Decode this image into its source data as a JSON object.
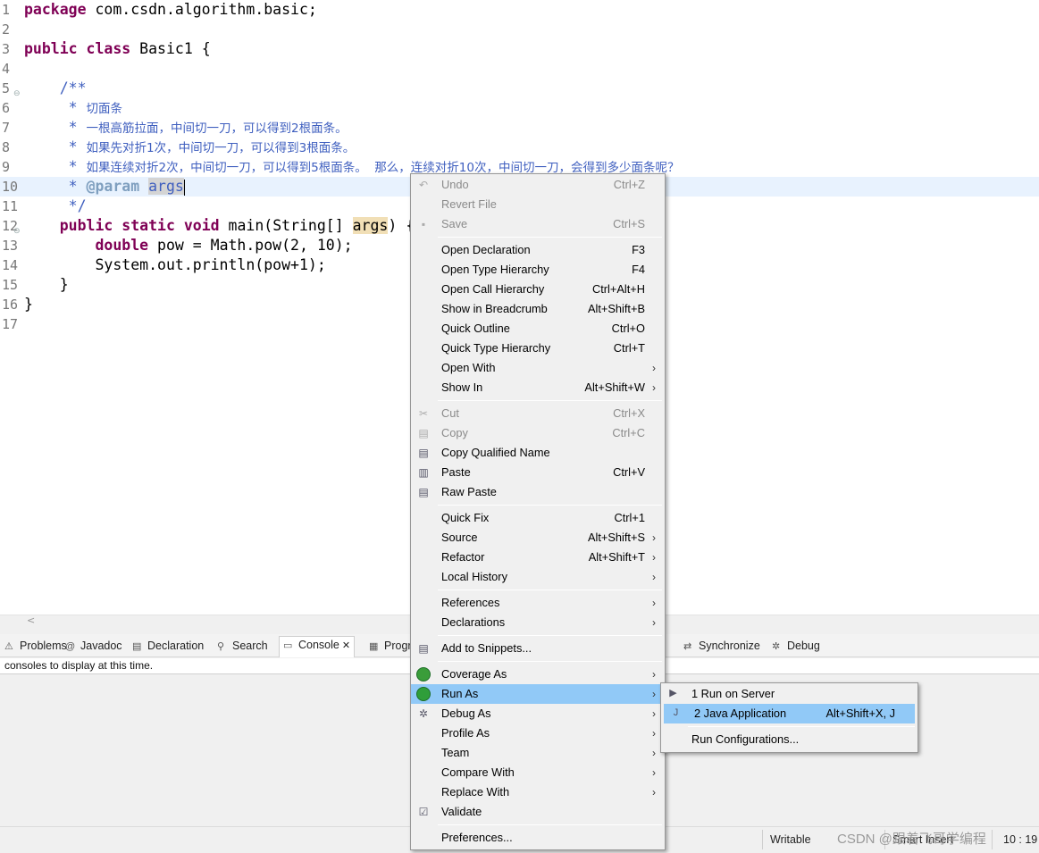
{
  "editor": {
    "lines": [
      {
        "num": "1",
        "parts": [
          {
            "t": "package",
            "c": "kw"
          },
          {
            "t": " com.csdn.algorithm.basic;"
          }
        ]
      },
      {
        "num": "2",
        "parts": []
      },
      {
        "num": "3",
        "parts": [
          {
            "t": "public",
            "c": "kw"
          },
          {
            "t": " "
          },
          {
            "t": "class",
            "c": "kw"
          },
          {
            "t": " Basic1 {"
          }
        ]
      },
      {
        "num": "4",
        "parts": []
      },
      {
        "num": "5",
        "fold": true,
        "parts": [
          {
            "t": "    /**",
            "c": "jd"
          }
        ]
      },
      {
        "num": "6",
        "parts": [
          {
            "t": "     * ",
            "c": "jd"
          },
          {
            "t": "切面条",
            "c": "jdz"
          }
        ]
      },
      {
        "num": "7",
        "parts": [
          {
            "t": "     * ",
            "c": "jd"
          },
          {
            "t": "一根高筋拉面，中间切一刀，可以得到2根面条。",
            "c": "jdz"
          }
        ]
      },
      {
        "num": "8",
        "parts": [
          {
            "t": "     * ",
            "c": "jd"
          },
          {
            "t": "如果先对折1次，中间切一刀，可以得到3根面条。",
            "c": "jdz"
          }
        ]
      },
      {
        "num": "9",
        "parts": [
          {
            "t": "     * ",
            "c": "jd"
          },
          {
            "t": "如果连续对折2次，中间切一刀，可以得到5根面条。  那么，连续对折10次，中间切一刀，会得到多少面条呢？",
            "c": "jdz"
          }
        ]
      },
      {
        "num": "10",
        "current": true,
        "parts": [
          {
            "t": "     * ",
            "c": "jd"
          },
          {
            "t": "@param",
            "c": "tag"
          },
          {
            "t": " "
          },
          {
            "t": "args",
            "c": "jd hl"
          },
          {
            "caret": true
          }
        ]
      },
      {
        "num": "11",
        "parts": [
          {
            "t": "     */",
            "c": "jd"
          }
        ]
      },
      {
        "num": "12",
        "fold": true,
        "parts": [
          {
            "t": "    "
          },
          {
            "t": "public",
            "c": "kw"
          },
          {
            "t": " "
          },
          {
            "t": "static",
            "c": "kw"
          },
          {
            "t": " "
          },
          {
            "t": "void",
            "c": "kw"
          },
          {
            "t": " main(String[] "
          },
          {
            "t": "args",
            "c": "hl2"
          },
          {
            "t": ") {"
          }
        ]
      },
      {
        "num": "13",
        "parts": [
          {
            "t": "        "
          },
          {
            "t": "double",
            "c": "kw"
          },
          {
            "t": " pow = Math.pow(2, 10);"
          }
        ]
      },
      {
        "num": "14",
        "parts": [
          {
            "t": "        System.out.println(pow+1);"
          }
        ]
      },
      {
        "num": "15",
        "parts": [
          {
            "t": "    }"
          }
        ]
      },
      {
        "num": "16",
        "parts": [
          {
            "t": "}"
          }
        ]
      },
      {
        "num": "17",
        "parts": []
      }
    ]
  },
  "views": {
    "tabs": [
      {
        "id": "problems",
        "label": "Problems",
        "icon": "problems-icon",
        "glyph": "⚠"
      },
      {
        "id": "javadoc",
        "label": "Javadoc",
        "icon": "javadoc-icon",
        "glyph": "@"
      },
      {
        "id": "declaration",
        "label": "Declaration",
        "icon": "declaration-icon",
        "glyph": "▤"
      },
      {
        "id": "search",
        "label": "Search",
        "icon": "search-icon",
        "glyph": "⚲"
      },
      {
        "id": "console",
        "label": "Console",
        "icon": "console-icon",
        "glyph": "▭",
        "active": true,
        "close": "✕"
      },
      {
        "id": "progress",
        "label": "Progr",
        "icon": "progress-icon",
        "glyph": "▦"
      },
      {
        "id": "servers",
        "label": "rs",
        "icon": "servers-icon",
        "glyph": ""
      },
      {
        "id": "synchronize",
        "label": "Synchronize",
        "icon": "synchronize-icon",
        "glyph": "⇄"
      },
      {
        "id": "debug",
        "label": "Debug",
        "icon": "debug-icon",
        "glyph": "✲"
      }
    ],
    "console_message": "consoles to display at this time."
  },
  "status": {
    "writable": "Writable",
    "insert_mode": "Smart Insert",
    "position": "10 : 19",
    "watermark": "CSDN @跟着飞哥学编程"
  },
  "context_menu": {
    "items": [
      {
        "type": "item",
        "label": "Undo",
        "shortcut": "Ctrl+Z",
        "disabled": true,
        "icon": "undo-icon",
        "glyph": "↶"
      },
      {
        "type": "item",
        "label": "Revert File",
        "disabled": true
      },
      {
        "type": "item",
        "label": "Save",
        "shortcut": "Ctrl+S",
        "disabled": true,
        "icon": "save-icon",
        "glyph": "▪"
      },
      {
        "type": "sep"
      },
      {
        "type": "item",
        "label": "Open Declaration",
        "shortcut": "F3"
      },
      {
        "type": "item",
        "label": "Open Type Hierarchy",
        "shortcut": "F4"
      },
      {
        "type": "item",
        "label": "Open Call Hierarchy",
        "shortcut": "Ctrl+Alt+H"
      },
      {
        "type": "item",
        "label": "Show in Breadcrumb",
        "shortcut": "Alt+Shift+B"
      },
      {
        "type": "item",
        "label": "Quick Outline",
        "shortcut": "Ctrl+O"
      },
      {
        "type": "item",
        "label": "Quick Type Hierarchy",
        "shortcut": "Ctrl+T"
      },
      {
        "type": "item",
        "label": "Open With",
        "submenu": true
      },
      {
        "type": "item",
        "label": "Show In",
        "shortcut": "Alt+Shift+W",
        "submenu": true
      },
      {
        "type": "sep"
      },
      {
        "type": "item",
        "label": "Cut",
        "shortcut": "Ctrl+X",
        "disabled": true,
        "icon": "cut-icon",
        "glyph": "✂"
      },
      {
        "type": "item",
        "label": "Copy",
        "shortcut": "Ctrl+C",
        "disabled": true,
        "icon": "copy-icon",
        "glyph": "▤"
      },
      {
        "type": "item",
        "label": "Copy Qualified Name",
        "icon": "copy-qualified-name-icon",
        "glyph": "▤"
      },
      {
        "type": "item",
        "label": "Paste",
        "shortcut": "Ctrl+V",
        "icon": "paste-icon",
        "glyph": "▥"
      },
      {
        "type": "item",
        "label": "Raw Paste",
        "icon": "raw-paste-icon",
        "glyph": "▤"
      },
      {
        "type": "sep"
      },
      {
        "type": "item",
        "label": "Quick Fix",
        "shortcut": "Ctrl+1"
      },
      {
        "type": "item",
        "label": "Source",
        "shortcut": "Alt+Shift+S",
        "submenu": true
      },
      {
        "type": "item",
        "label": "Refactor",
        "shortcut": "Alt+Shift+T",
        "submenu": true
      },
      {
        "type": "item",
        "label": "Local History",
        "submenu": true
      },
      {
        "type": "sep"
      },
      {
        "type": "item",
        "label": "References",
        "submenu": true
      },
      {
        "type": "item",
        "label": "Declarations",
        "submenu": true
      },
      {
        "type": "sep"
      },
      {
        "type": "item",
        "label": "Add to Snippets...",
        "icon": "snippets-icon",
        "glyph": "▤"
      },
      {
        "type": "sep"
      },
      {
        "type": "item",
        "label": "Coverage As",
        "submenu": true,
        "icon": "coverage-icon",
        "circle": "#3a9d3a"
      },
      {
        "type": "item",
        "label": "Run As",
        "submenu": true,
        "selected": true,
        "icon": "run-icon",
        "circle": "#2f9e3a"
      },
      {
        "type": "item",
        "label": "Debug As",
        "submenu": true,
        "icon": "debug-as-icon",
        "glyph": "✲"
      },
      {
        "type": "item",
        "label": "Profile As",
        "submenu": true
      },
      {
        "type": "item",
        "label": "Team",
        "submenu": true
      },
      {
        "type": "item",
        "label": "Compare With",
        "submenu": true
      },
      {
        "type": "item",
        "label": "Replace With",
        "submenu": true
      },
      {
        "type": "item",
        "label": "Validate",
        "icon": "checkmark-icon",
        "glyph": "☑"
      },
      {
        "type": "sep"
      },
      {
        "type": "item",
        "label": "Preferences..."
      }
    ]
  },
  "submenu": {
    "items": [
      {
        "type": "item",
        "label": "1 Run on Server",
        "icon": "run-on-server-icon",
        "glyph": "▶"
      },
      {
        "type": "item",
        "label": "2 Java Application",
        "shortcut": "Alt+Shift+X, J",
        "selected": true,
        "icon": "java-application-icon",
        "glyph": "J"
      },
      {
        "type": "sep"
      },
      {
        "type": "item",
        "label": "Run Configurations..."
      }
    ]
  }
}
